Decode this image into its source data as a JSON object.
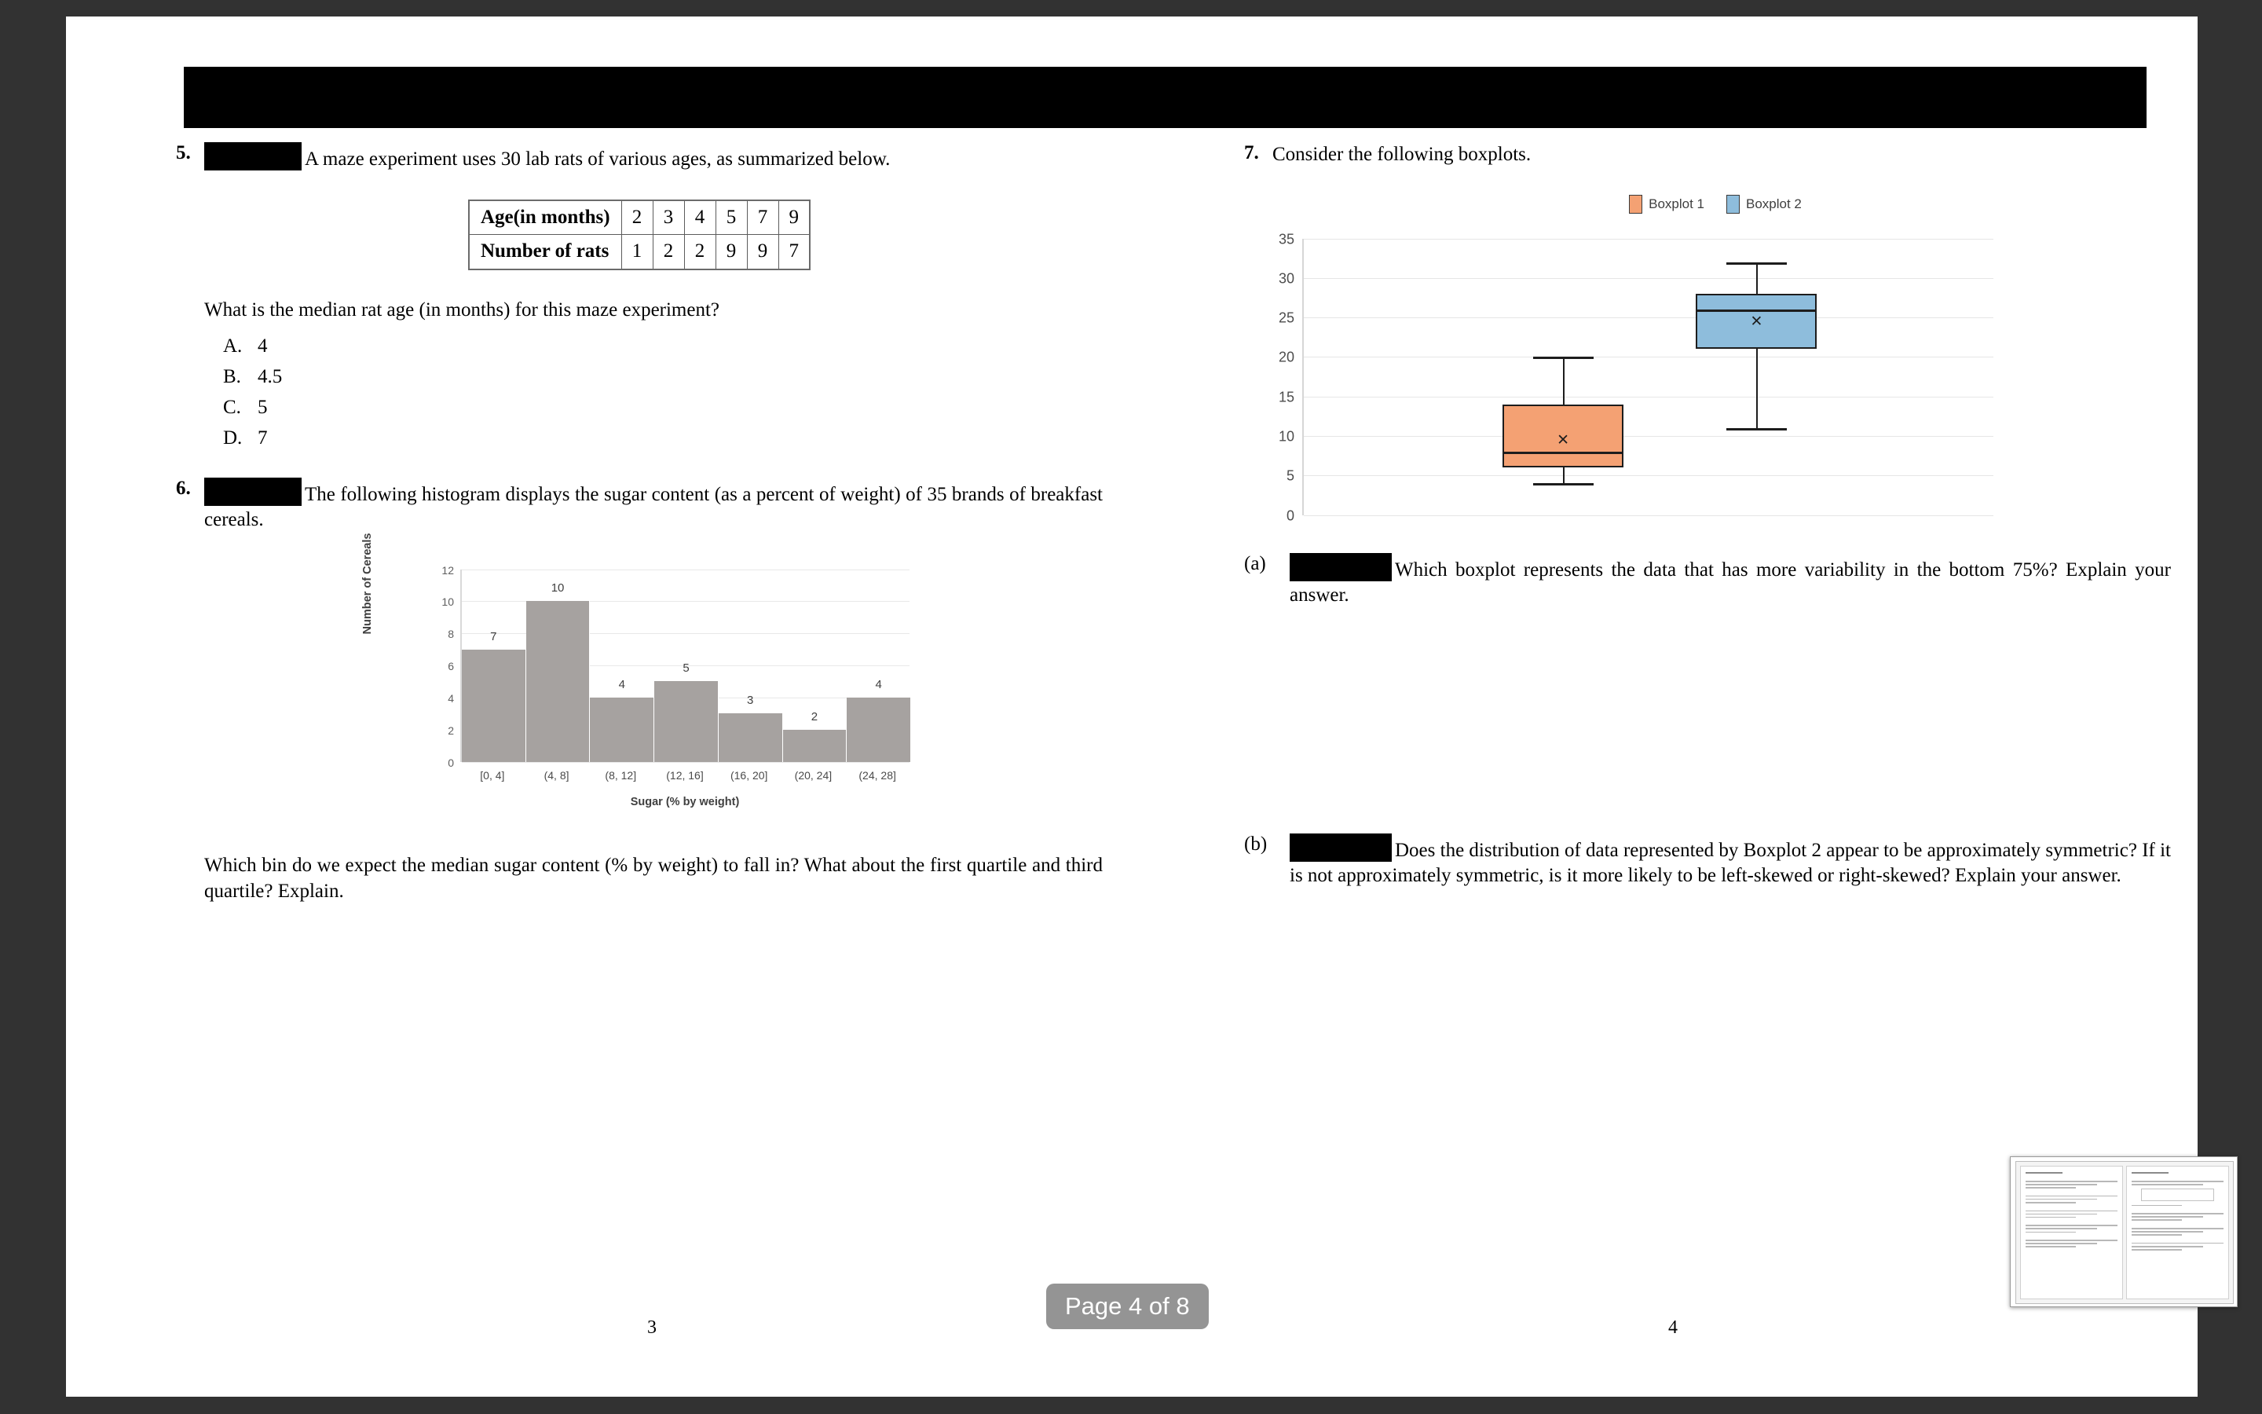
{
  "viewer": {
    "page_indicator": "Page 4 of 8",
    "background_color": "#323232",
    "page_background": "#ffffff"
  },
  "header": {
    "redaction_label": "redacted-header-bar"
  },
  "questions": [
    {
      "id": "q5",
      "number": "5.",
      "redacted": true,
      "prompt": "A maze experiment uses 30 lab rats of various ages, as summarized below.",
      "table": {
        "row_headers": [
          "Age(in months)",
          "Number of rats"
        ],
        "rows": [
          [
            "2",
            "3",
            "4",
            "5",
            "7",
            "9"
          ],
          [
            "1",
            "2",
            "2",
            "9",
            "9",
            "7"
          ]
        ]
      },
      "sub_prompt": "What is the median rat age (in months) for this maze experiment?",
      "choices": [
        {
          "label": "A.",
          "text": "4"
        },
        {
          "label": "B.",
          "text": "4.5"
        },
        {
          "label": "C.",
          "text": "5"
        },
        {
          "label": "D.",
          "text": "7"
        }
      ]
    },
    {
      "id": "q6",
      "number": "6.",
      "redacted": true,
      "prompt": "The following histogram displays the sugar content (as a percent of weight) of 35 brands of breakfast cereals.",
      "follow_up": "Which bin do we expect the median sugar content (% by weight) to fall in? What about the first quartile and third quartile? Explain."
    },
    {
      "id": "q7",
      "number": "7.",
      "redacted": false,
      "prompt": "Consider the following boxplots.",
      "parts": [
        {
          "label": "(a)",
          "redacted": true,
          "text": "Which boxplot represents the data that has more variability in the bottom 75%? Explain your answer."
        },
        {
          "label": "(b)",
          "redacted": true,
          "text": "Does the distribution of data represented by Boxplot 2 appear to be approximately symmetric? If it is not approximately symmetric, is it more likely to be left-skewed or right-skewed? Explain your answer."
        }
      ]
    }
  ],
  "chart_data": [
    {
      "type": "bar",
      "id": "sugar-histogram",
      "title": "",
      "xlabel": "Sugar (% by weight)",
      "ylabel": "Number of Cereals",
      "categories": [
        "[0, 4]",
        "(4, 8]",
        "(8, 12]",
        "(12, 16]",
        "(16, 20]",
        "(20, 24]",
        "(24, 28]"
      ],
      "values": [
        7,
        10,
        4,
        5,
        3,
        2,
        4
      ],
      "ylim": [
        0,
        12
      ],
      "yticks": [
        0,
        2,
        4,
        6,
        8,
        10,
        12
      ],
      "grid": true,
      "legend": "none",
      "bar_color": "#a6a2a0",
      "data_labels": true
    },
    {
      "type": "boxplot",
      "id": "comparison-boxplots",
      "title": "",
      "xlabel": "",
      "ylabel": "",
      "ylim": [
        0,
        35
      ],
      "yticks": [
        0,
        5,
        10,
        15,
        20,
        25,
        30,
        35
      ],
      "grid": true,
      "legend": "top-center",
      "series": [
        {
          "name": "Boxplot 1",
          "color": "#F4A173",
          "min": 4,
          "q1": 6,
          "median": 8,
          "q3": 14,
          "max": 20,
          "mean": 9.5
        },
        {
          "name": "Boxplot 2",
          "color": "#8EBDDC",
          "min": 11,
          "q1": 21,
          "median": 26,
          "q3": 28,
          "max": 32,
          "mean": 24.5
        }
      ]
    }
  ],
  "footer": {
    "left_folio": "3",
    "right_folio": "4"
  },
  "thumbnail": {
    "name": "page-thumbnail-preview"
  }
}
